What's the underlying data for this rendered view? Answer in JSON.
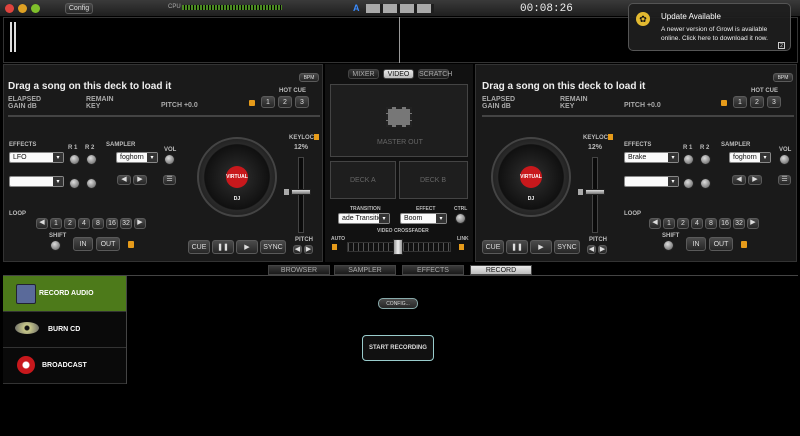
{
  "titlebar": {
    "config": "Config",
    "cpu": "CPU",
    "time": "00:08:26",
    "deck_mode": "A"
  },
  "growl": {
    "title": "Update Available",
    "body": "A newer version of Growl is available online. Click here to download it now."
  },
  "decks": [
    {
      "prompt": "Drag a song on this deck to load it",
      "bpm": "BPM",
      "elapsed": "ELAPSED",
      "gain": "GAIN dB",
      "remain": "REMAIN",
      "key": "KEY",
      "pitch": "PITCH +0.0",
      "hotcue": "HOT CUE",
      "cues": [
        "1",
        "2",
        "3"
      ],
      "effects": "EFFECTS",
      "effect_sel": "LFO",
      "r1": "R 1",
      "r2": "R 2",
      "sampler": "SAMPLER",
      "sampler_sel": "foghorn",
      "vol": "VOL",
      "keylock": "KEYLOCK",
      "pitch_pct": "12%",
      "pitch_lbl": "PITCH",
      "loop": "LOOP",
      "loops": [
        "1",
        "2",
        "4",
        "8",
        "16",
        "32"
      ],
      "shift": "SHIFT",
      "in": "IN",
      "out": "OUT",
      "cue": "CUE",
      "sync": "SYNC",
      "vd": "VIRTUAL DJ"
    },
    {
      "prompt": "Drag a song on this deck to load it",
      "bpm": "BPM",
      "elapsed": "ELAPSED",
      "gain": "GAIN dB",
      "remain": "REMAIN",
      "key": "KEY",
      "pitch": "PITCH +0.0",
      "hotcue": "HOT CUE",
      "cues": [
        "1",
        "2",
        "3"
      ],
      "effects": "EFFECTS",
      "effect_sel": "Brake",
      "r1": "R 1",
      "r2": "R 2",
      "sampler": "SAMPLER",
      "sampler_sel": "foghorn",
      "vol": "VOL",
      "keylock": "KEYLOCK",
      "pitch_pct": "12%",
      "pitch_lbl": "PITCH",
      "loop": "LOOP",
      "loops": [
        "1",
        "2",
        "4",
        "8",
        "16",
        "32"
      ],
      "shift": "SHIFT",
      "in": "IN",
      "out": "OUT",
      "cue": "CUE",
      "sync": "SYNC",
      "vd": "VIRTUAL DJ"
    }
  ],
  "center": {
    "tabs": [
      "MIXER",
      "VIDEO",
      "SCRATCH"
    ],
    "master": "MASTER OUT",
    "deckA": "DECK A",
    "deckB": "DECK B",
    "transition": "TRANSITION",
    "effect": "EFFECT",
    "ctrl": "CTRL",
    "trans_sel": "ade Transitio",
    "effect_sel": "Boom",
    "crossfader": "VIDEO CROSSFADER",
    "auto": "AUTO",
    "link": "LINK"
  },
  "bottom_tabs": [
    "BROWSER",
    "SAMPLER",
    "EFFECTS",
    "RECORD"
  ],
  "side": [
    {
      "label": "RECORD AUDIO"
    },
    {
      "label": "BURN CD"
    },
    {
      "label": "BROADCAST"
    }
  ],
  "record": {
    "config": "CONFIG...",
    "start": "START RECORDING"
  },
  "colors": {
    "record_active": "#4d7a1a",
    "turntable_label": "#c8181c"
  }
}
